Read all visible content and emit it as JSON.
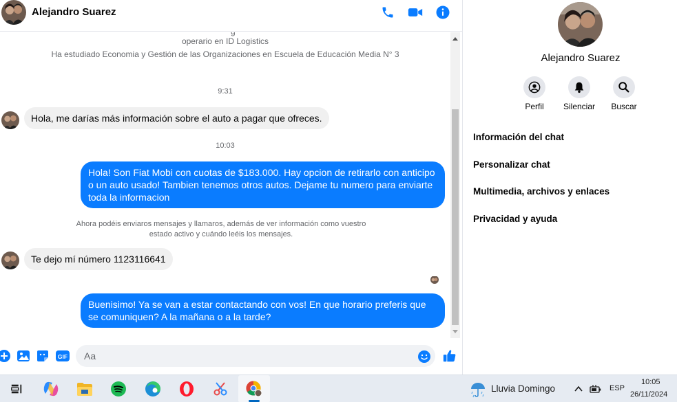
{
  "header": {
    "contact_name": "Alejandro Suarez"
  },
  "profile_info": {
    "cut_line": "g",
    "line1": "operario en ID Logistics",
    "line2": "Ha estudiado Economia y Gestión de las Organizaciones en Escuela de Educación Media N° 3"
  },
  "messages": {
    "time1": "9:31",
    "in1": "Hola, me darías más información sobre el auto a pagar que ofreces.",
    "time2": "10:03",
    "out1": "Hola! Son Fiat Mobi con cuotas de $183.000. Hay opcion de retirarlo con anticipo o un auto usado! Tambien tenemos otros autos. Dejame tu numero para enviarte toda la informacion",
    "notice": "Ahora podéis enviaros mensajes y llamaros, además de ver información como vuestro estado activo y cuándo leéis los mensajes.",
    "in2": "Te dejo mí número 1123116641",
    "out2": "Buenisimo! Ya se van a estar contactando con vos! En que horario preferis que se comuniquen? A la mañana o a la tarde?"
  },
  "composer": {
    "placeholder": "Aa",
    "gif_label": "GIF"
  },
  "info_panel": {
    "name": "Alejandro Suarez",
    "actions": [
      {
        "label": "Perfil",
        "icon": "profile-icon"
      },
      {
        "label": "Silenciar",
        "icon": "bell-icon"
      },
      {
        "label": "Buscar",
        "icon": "search-icon"
      }
    ],
    "links": [
      "Información del chat",
      "Personalizar chat",
      "Multimedia, archivos y enlaces",
      "Privacidad y ayuda"
    ]
  },
  "taskbar": {
    "weather": "Lluvia Domingo",
    "language": "ESP",
    "time": "10:05",
    "date": "26/11/2024"
  },
  "colors": {
    "accent": "#0a7cff",
    "incoming_bubble": "#f0f0f0",
    "taskbar": "#e6ebf2"
  }
}
